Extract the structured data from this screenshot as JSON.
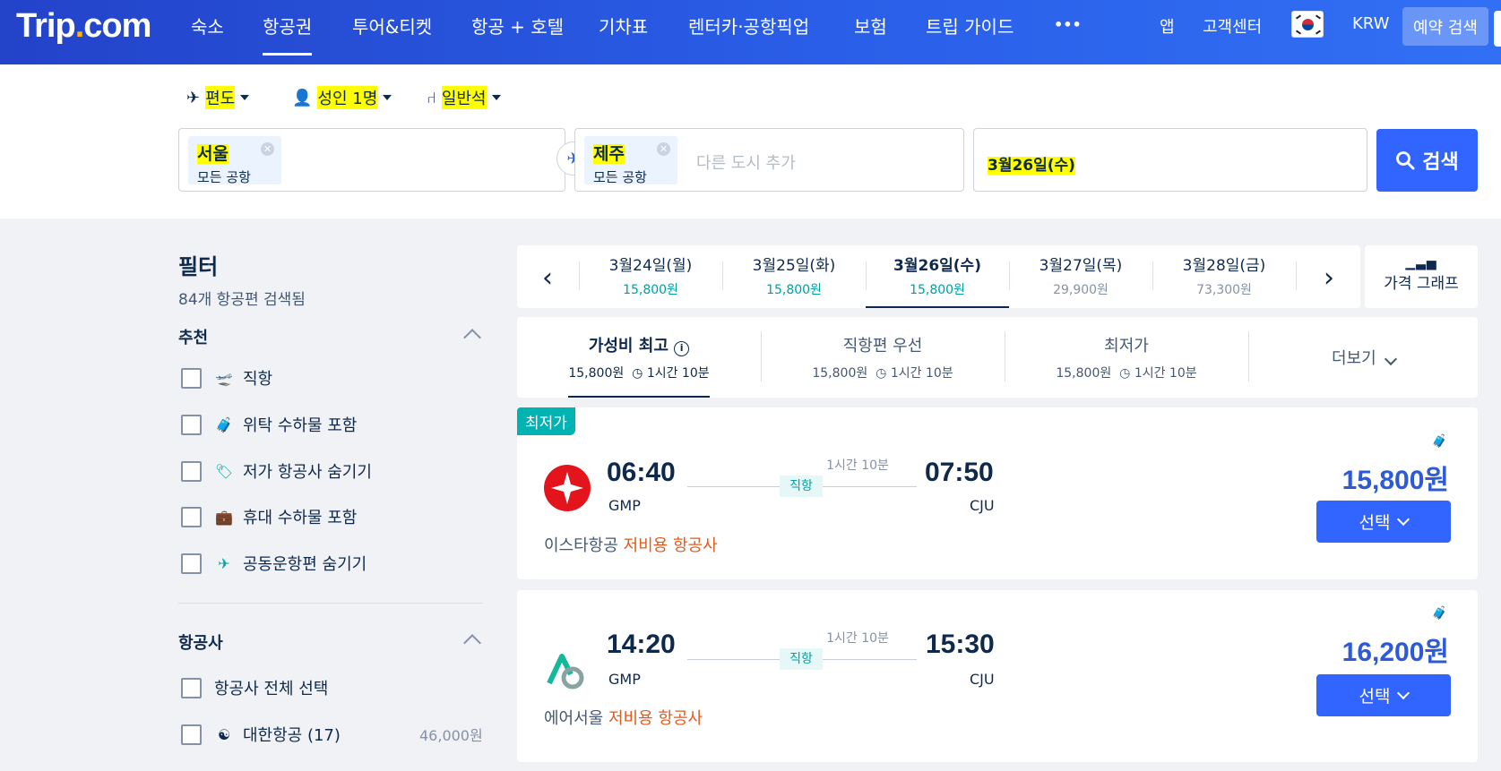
{
  "nav": {
    "logo_main": "Trip",
    "logo_dot": ".",
    "logo_tld": "com",
    "items": [
      "숙소",
      "항공권",
      "투어&티켓",
      "항공 + 호텔",
      "기차표",
      "렌터카·공항픽업",
      "보험",
      "트립 가이드",
      "•••"
    ],
    "app": "앱",
    "support": "고객센터",
    "currency": "KRW",
    "my_bookings": "예약 검색"
  },
  "search": {
    "trip_type": "편도",
    "passengers": "성인 1명",
    "cabin": "일반석",
    "from_city": "서울",
    "from_sub": "모든 공항",
    "to_city": "제주",
    "to_sub": "모든 공항",
    "add_city_placeholder": "다른 도시 추가",
    "date": "3월26일(수)",
    "search_label": "검색"
  },
  "filter": {
    "title": "필터",
    "count": "84개 항공편 검색됨",
    "recommended_title": "추천",
    "recommended": [
      {
        "label": "직항",
        "icon": "plane-takeoff-icon"
      },
      {
        "label": "위탁 수하물 포함",
        "icon": "luggage-icon"
      },
      {
        "label": "저가 항공사 숨기기",
        "icon": "tag-icon"
      },
      {
        "label": "휴대 수하물 포함",
        "icon": "carry-on-icon"
      },
      {
        "label": "공동운항편 숨기기",
        "icon": "codeshare-icon"
      }
    ],
    "airlines_title": "항공사",
    "select_all": "항공사 전체 선택",
    "airline": {
      "label": "대한항공 (17)",
      "price": "46,000원"
    }
  },
  "datebar": {
    "dates": [
      {
        "date": "3월24일(월)",
        "price": "15,800원",
        "cheap": true
      },
      {
        "date": "3월25일(화)",
        "price": "15,800원",
        "cheap": true
      },
      {
        "date": "3월26일(수)",
        "price": "15,800원",
        "cheap": true
      },
      {
        "date": "3월27일(목)",
        "price": "29,900원",
        "cheap": false
      },
      {
        "date": "3월28일(금)",
        "price": "73,300원",
        "cheap": false
      }
    ],
    "price_graph": "가격 그래프"
  },
  "sort": {
    "tabs": [
      {
        "title": "가성비 최고",
        "price": "15,800원",
        "duration": "1시간 10분"
      },
      {
        "title": "직항편 우선",
        "price": "15,800원",
        "duration": "1시간 10분"
      },
      {
        "title": "최저가",
        "price": "15,800원",
        "duration": "1시간 10분"
      }
    ],
    "more": "더보기"
  },
  "flights": [
    {
      "tag": "최저가",
      "dep_time": "06:40",
      "dep_code": "GMP",
      "arr_time": "07:50",
      "arr_code": "CJU",
      "duration": "1시간 10분",
      "direct": "직항",
      "airline": "이스타항공",
      "lcc": "저비용 항공사",
      "price": "15,800원",
      "select": "선택",
      "logo_color": "#e4141d"
    },
    {
      "dep_time": "14:20",
      "dep_code": "GMP",
      "arr_time": "15:30",
      "arr_code": "CJU",
      "duration": "1시간 10분",
      "direct": "직항",
      "airline": "에어서울",
      "lcc": "저비용 항공사",
      "price": "16,200원",
      "select": "선택",
      "logo_color": "#16b89c"
    }
  ],
  "colors": {
    "brand": "#2a5ee8",
    "button": "#3264ff",
    "teal": "#00a8a8",
    "lcc_orange": "#e15a1e"
  }
}
